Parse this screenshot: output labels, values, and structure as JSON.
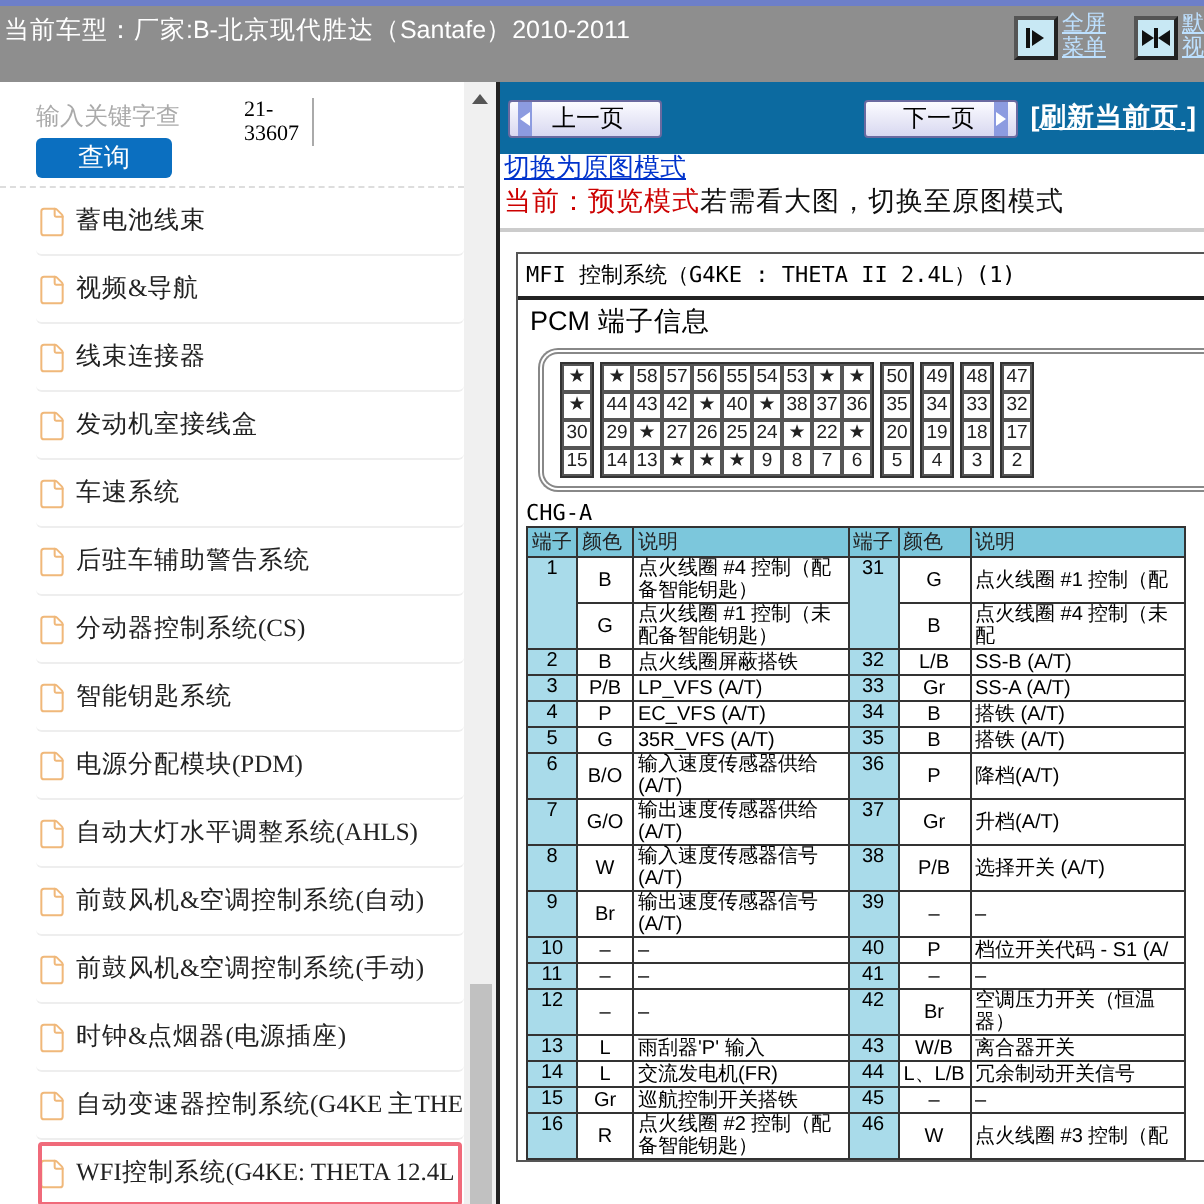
{
  "top_bar": {
    "title": "当前车型：厂家:B-北京现代胜达（Santafe）2010-2011",
    "buttons": [
      {
        "kind": "fullscreen",
        "lines": [
          "全屏",
          "菜单"
        ]
      },
      {
        "kind": "default",
        "lines": [
          "默",
          "视"
        ]
      }
    ]
  },
  "sidebar": {
    "search": {
      "placeholder": "输入关键字查",
      "button": "查询",
      "code": "21-33607"
    },
    "items": [
      {
        "label": "蓄电池线束",
        "selected": false
      },
      {
        "label": "视频&导航",
        "selected": false
      },
      {
        "label": "线束连接器",
        "selected": false
      },
      {
        "label": "发动机室接线盒",
        "selected": false
      },
      {
        "label": "车速系统",
        "selected": false
      },
      {
        "label": "后驻车辅助警告系统",
        "selected": false
      },
      {
        "label": "分动器控制系统(CS)",
        "selected": false
      },
      {
        "label": "智能钥匙系统",
        "selected": false
      },
      {
        "label": "电源分配模块(PDM)",
        "selected": false
      },
      {
        "label": "自动大灯水平调整系统(AHLS)",
        "selected": false
      },
      {
        "label": "前鼓风机&空调控制系统(自动)",
        "selected": false
      },
      {
        "label": "前鼓风机&空调控制系统(手动)",
        "selected": false
      },
      {
        "label": "时钟&点烟器(电源插座)",
        "selected": false
      },
      {
        "label": "自动变速器控制系统(G4KE 主THE",
        "selected": false
      },
      {
        "label": "WFI控制系统(G4KE: THETA 12.4L",
        "selected": true
      }
    ]
  },
  "viewer": {
    "prev_button": "上一页",
    "next_button": "下一页",
    "refresh_link": "[刷新当前页.]",
    "switch_link": "切换为原图模式",
    "mode_label": "当前：预览模式",
    "mode_hint": "若需看大图，切换至原图模式",
    "document": {
      "title": "MFI 控制系统（G4KE : THETA II 2.4L）(1)",
      "subtitle": "PCM 端子信息",
      "connector_groups": [
        {
          "rows": [
            [
              "★"
            ],
            [
              "★"
            ],
            [
              "30"
            ],
            [
              "15"
            ]
          ]
        },
        {
          "rows": [
            [
              "★",
              "58",
              "57",
              "56",
              "55",
              "54",
              "53",
              "★",
              "★"
            ],
            [
              "44",
              "43",
              "42",
              "★",
              "40",
              "★",
              "38",
              "37",
              "36"
            ],
            [
              "29",
              "★",
              "27",
              "26",
              "25",
              "24",
              "★",
              "22",
              "★"
            ],
            [
              "14",
              "13",
              "★",
              "★",
              "★",
              "9",
              "8",
              "7",
              "6"
            ]
          ]
        },
        {
          "rows": [
            [
              "50"
            ],
            [
              "35"
            ],
            [
              "20"
            ],
            [
              "5"
            ]
          ]
        },
        {
          "rows": [
            [
              "49"
            ],
            [
              "34"
            ],
            [
              "19"
            ],
            [
              "4"
            ]
          ]
        },
        {
          "rows": [
            [
              "48"
            ],
            [
              "33"
            ],
            [
              "18"
            ],
            [
              "3"
            ]
          ]
        },
        {
          "rows": [
            [
              "47"
            ],
            [
              "32"
            ],
            [
              "17"
            ],
            [
              "2"
            ]
          ]
        }
      ],
      "connector_label": "CHG-A",
      "columns": [
        "端子",
        "颜色",
        "说明",
        "端子",
        "颜色",
        "说明"
      ],
      "rows": [
        {
          "left": {
            "pin": "1",
            "entries": [
              {
                "wire": "B",
                "desc": "点火线圈 #4 控制（配备智能钥匙）"
              },
              {
                "wire": "G",
                "desc": "点火线圈 #1 控制（未配备智能钥匙）"
              }
            ]
          },
          "right": {
            "pin": "31",
            "entries": [
              {
                "wire": "G",
                "desc": "点火线圈 #1 控制（配"
              },
              {
                "wire": "B",
                "desc": "点火线圈 #4 控制（未配"
              }
            ]
          }
        },
        {
          "left": {
            "pin": "2",
            "entries": [
              {
                "wire": "B",
                "desc": "点火线圈屏蔽搭铁"
              }
            ]
          },
          "right": {
            "pin": "32",
            "entries": [
              {
                "wire": "L/B",
                "desc": "SS-B (A/T)"
              }
            ]
          }
        },
        {
          "left": {
            "pin": "3",
            "entries": [
              {
                "wire": "P/B",
                "desc": "LP_VFS (A/T)"
              }
            ]
          },
          "right": {
            "pin": "33",
            "entries": [
              {
                "wire": "Gr",
                "desc": "SS-A (A/T)"
              }
            ]
          }
        },
        {
          "left": {
            "pin": "4",
            "entries": [
              {
                "wire": "P",
                "desc": "EC_VFS (A/T)"
              }
            ]
          },
          "right": {
            "pin": "34",
            "entries": [
              {
                "wire": "B",
                "desc": "搭铁 (A/T)"
              }
            ]
          }
        },
        {
          "left": {
            "pin": "5",
            "entries": [
              {
                "wire": "G",
                "desc": "35R_VFS (A/T)"
              }
            ]
          },
          "right": {
            "pin": "35",
            "entries": [
              {
                "wire": "B",
                "desc": "搭铁 (A/T)"
              }
            ]
          }
        },
        {
          "left": {
            "pin": "6",
            "entries": [
              {
                "wire": "B/O",
                "desc": "输入速度传感器供给 (A/T)"
              }
            ]
          },
          "right": {
            "pin": "36",
            "entries": [
              {
                "wire": "P",
                "desc": "降档(A/T)"
              }
            ]
          }
        },
        {
          "left": {
            "pin": "7",
            "entries": [
              {
                "wire": "G/O",
                "desc": "输出速度传感器供给 (A/T)"
              }
            ]
          },
          "right": {
            "pin": "37",
            "entries": [
              {
                "wire": "Gr",
                "desc": "升档(A/T)"
              }
            ]
          }
        },
        {
          "left": {
            "pin": "8",
            "entries": [
              {
                "wire": "W",
                "desc": "输入速度传感器信号 (A/T)"
              }
            ]
          },
          "right": {
            "pin": "38",
            "entries": [
              {
                "wire": "P/B",
                "desc": "选择开关 (A/T)"
              }
            ]
          }
        },
        {
          "left": {
            "pin": "9",
            "entries": [
              {
                "wire": "Br",
                "desc": "输出速度传感器信号 (A/T)"
              }
            ]
          },
          "right": {
            "pin": "39",
            "entries": [
              {
                "wire": "–",
                "desc": "–"
              }
            ]
          }
        },
        {
          "left": {
            "pin": "10",
            "entries": [
              {
                "wire": "–",
                "desc": "–"
              }
            ]
          },
          "right": {
            "pin": "40",
            "entries": [
              {
                "wire": "P",
                "desc": "档位开关代码 - S1 (A/"
              }
            ]
          }
        },
        {
          "left": {
            "pin": "11",
            "entries": [
              {
                "wire": "–",
                "desc": "–"
              }
            ]
          },
          "right": {
            "pin": "41",
            "entries": [
              {
                "wire": "–",
                "desc": "–"
              }
            ]
          }
        },
        {
          "left": {
            "pin": "12",
            "entries": [
              {
                "wire": "–",
                "desc": "–"
              }
            ]
          },
          "right": {
            "pin": "42",
            "entries": [
              {
                "wire": "Br",
                "desc": "空调压力开关（恒温器）"
              }
            ]
          }
        },
        {
          "left": {
            "pin": "13",
            "entries": [
              {
                "wire": "L",
                "desc": "雨刮器'P' 输入"
              }
            ]
          },
          "right": {
            "pin": "43",
            "entries": [
              {
                "wire": "W/B",
                "desc": "离合器开关"
              }
            ]
          }
        },
        {
          "left": {
            "pin": "14",
            "entries": [
              {
                "wire": "L",
                "desc": "交流发电机(FR)"
              }
            ]
          },
          "right": {
            "pin": "44",
            "entries": [
              {
                "wire": "L、L/B",
                "desc": "冗余制动开关信号"
              }
            ]
          }
        },
        {
          "left": {
            "pin": "15",
            "entries": [
              {
                "wire": "Gr",
                "desc": "巡航控制开关搭铁"
              }
            ]
          },
          "right": {
            "pin": "45",
            "entries": [
              {
                "wire": "–",
                "desc": "–"
              }
            ]
          }
        },
        {
          "left": {
            "pin": "16",
            "entries": [
              {
                "wire": "R",
                "desc": "点火线圈 #2 控制（配备智能钥匙）"
              }
            ]
          },
          "right": {
            "pin": "46",
            "entries": [
              {
                "wire": "W",
                "desc": "点火线圈 #3 控制（配"
              }
            ]
          }
        }
      ]
    }
  }
}
